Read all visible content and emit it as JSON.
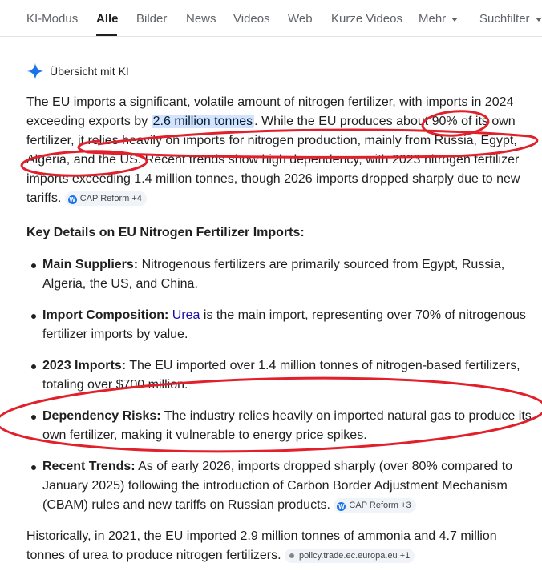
{
  "tabs": {
    "ki_modus": "KI-Modus",
    "alle": "Alle",
    "bilder": "Bilder",
    "news": "News",
    "videos": "Videos",
    "web": "Web",
    "kurze_videos": "Kurze Videos",
    "mehr": "Mehr",
    "suchfilter": "Suchfilter"
  },
  "ai_overview": {
    "title": "Übersicht mit KI",
    "intro": {
      "t1": "The EU imports a significant, volatile amount of nitrogen fertilizer, with imports in 2024 exceeding exports by ",
      "highlight": "2.6 million tonnes",
      "t2": ". While the EU produces about 90% of its own fertilizer, it relies heavily on imports for nitrogen production, mainly from Russia, Egypt, Algeria, and the US. Recent trends show high dependency, with 2023 nitrogen fertilizer imports exceeding 1.4 million tonnes, though 2026 imports dropped sharply due to new tariffs.",
      "chip": "CAP Reform +4"
    },
    "section_heading": "Key Details on EU Nitrogen Fertilizer Imports:",
    "bullets": [
      {
        "label": "Main Suppliers:",
        "text": " Nitrogenous fertilizers are primarily sourced from Egypt, Russia, Algeria, the US, and China."
      },
      {
        "label": "Import Composition:",
        "link": "Urea",
        "text": " is the main import, representing over 70% of nitrogenous fertilizer imports by value."
      },
      {
        "label": "2023 Imports:",
        "text": " The EU imported over 1.4 million tonnes of nitrogen-based fertilizers, totaling over $700 million."
      },
      {
        "label": "Dependency Risks:",
        "text": " The industry relies heavily on imported natural gas to produce its own fertilizer, making it vulnerable to energy price spikes."
      },
      {
        "label": "Recent Trends:",
        "text": " As of early 2026, imports dropped sharply (over 80% compared to January 2025) following the introduction of Carbon Border Adjustment Mechanism (CBAM) rules and new tariffs on Russian products.",
        "chip": "CAP Reform +3"
      }
    ],
    "closing": {
      "text": "Historically, in 2021, the EU imported 2.9 million tonnes of ammonia and 4.7 million tonnes of urea to produce nitrogen fertilizers.",
      "chip": "policy.trade.ec.europa.eu +1"
    }
  },
  "colors": {
    "annotation": "#e2202c",
    "highlight_bg": "#d3e3fd",
    "link": "#1a0dab",
    "chip_bg": "#f0f4f9",
    "spark": "#1a73e8"
  }
}
